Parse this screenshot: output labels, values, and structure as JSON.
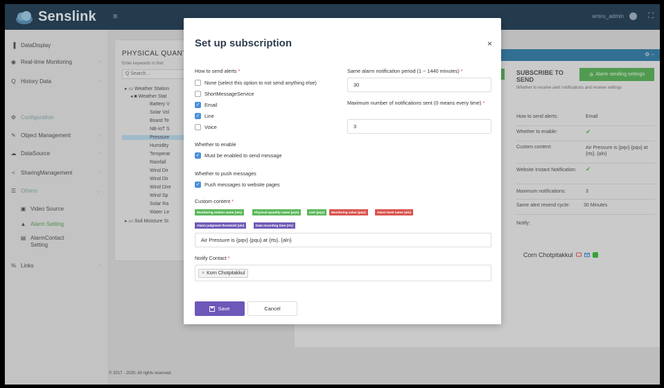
{
  "app": {
    "name": "Senslink",
    "menu_icon": "≡",
    "user": "wrsru_admin"
  },
  "sidebar": {
    "items": [
      {
        "label": "DataDisplay",
        "icon": "bar-chart-icon"
      },
      {
        "label": "Real-time Monitoring",
        "icon": "eye-icon"
      },
      {
        "label": "History Data",
        "icon": "search-icon"
      },
      {
        "label": "Configuration",
        "icon": "cogs-icon"
      },
      {
        "label": "Object Management",
        "icon": "wrench-icon"
      },
      {
        "label": "DataSource",
        "icon": "cloud-icon"
      },
      {
        "label": "SharingManagement",
        "icon": "share-icon"
      },
      {
        "label": "Others",
        "icon": "list-icon"
      },
      {
        "label": "Video Source",
        "icon": "video-icon"
      },
      {
        "label": "Alarm Setting",
        "icon": "bell-icon"
      },
      {
        "label": "AlarmContact",
        "label2": "Setting",
        "icon": "contact-icon"
      },
      {
        "label": "Links",
        "icon": "link-icon"
      }
    ]
  },
  "left_panel": {
    "title": "PHYSICAL QUANTI",
    "hint": "Enter keywords to find",
    "search_placeholder": "Q Search...",
    "tree": [
      "▸ ▭ Weather Station",
      "◂ ■ Weather Stat",
      "Battery V",
      "Solar Vol",
      "Board Te",
      "NB-IoT S",
      "Pressure",
      "Humidity",
      "Temperat",
      "Rainfall",
      "Wind Dir",
      "Wind Dir",
      "Wind Dire",
      "Wind Sp",
      "Solar Ra",
      "Water Le",
      "▸ ▭ Soil Moisture St"
    ]
  },
  "right_panel": {
    "subscribe_title": "SUBSCRIBE TO SEND",
    "alarm_btn": "Alarm sending settings",
    "desc": "Whether to receive alert notifications and receive settings",
    "rows": [
      {
        "label": "How to send alerts:",
        "value": "Email"
      },
      {
        "label": "Whether to enable:",
        "value": "✔"
      },
      {
        "label": "Custom content:",
        "value": "Air Pressure is {pqv} {pqu} at {rts}. {aln}"
      },
      {
        "label": "Website Instant Notification:",
        "value": "✔"
      },
      {
        "label": "Maximum notifications:",
        "value": "3"
      },
      {
        "label": "Same alert resend cycle:",
        "value": "30   Minutes"
      },
      {
        "label": "Notify:",
        "value": ""
      }
    ],
    "notify_person": "Corn Chotpitakkul"
  },
  "footer": "© 2017 - 2020. All rights reserved.",
  "modal": {
    "title": "Set up subscription",
    "close": "×",
    "how_label": "How to send alerts",
    "options": [
      {
        "label": "None (select this option to not send anything else)",
        "checked": false
      },
      {
        "label": "ShortMessageService",
        "checked": false
      },
      {
        "label": "Email",
        "checked": true
      },
      {
        "label": "Line",
        "checked": true
      },
      {
        "label": "Voice",
        "checked": false
      }
    ],
    "period_label": "Same alarm notification period (1 ~ 1440 minutes)",
    "period_value": "30",
    "max_label": "Maximum number of notifications sent (0 means every time)",
    "max_value": "3",
    "enable_label": "Whether to enable",
    "enable_option": "Must be enabled to send message",
    "push_label": "Whether to push messages",
    "push_option": "Push messages to website pages",
    "custom_label": "Custom content",
    "tags": [
      {
        "label": "Monitoring station name {stn}",
        "color": "#5cb85c"
      },
      {
        "label": "Physical quantity name {pqn}",
        "color": "#5cb85c"
      },
      {
        "label": "Unit {pqu}",
        "color": "#5cb85c"
      },
      {
        "label": "Monitoring value {pqv}",
        "color": "#d9534f"
      },
      {
        "label": "Alarm level name {aln}",
        "color": "#d9534f"
      },
      {
        "label": "Alarm judgment threshold {alv}",
        "color": "#6f5ab7"
      },
      {
        "label": "Data recording time {rts}",
        "color": "#6f5ab7"
      }
    ],
    "custom_value": "Air Pressure is {pqv} {pqu} at {rts}. {aln}",
    "notify_label": "Notify Contact",
    "contact": "Korn Chotpitakkul",
    "save": "Save",
    "cancel": "Cancel"
  }
}
